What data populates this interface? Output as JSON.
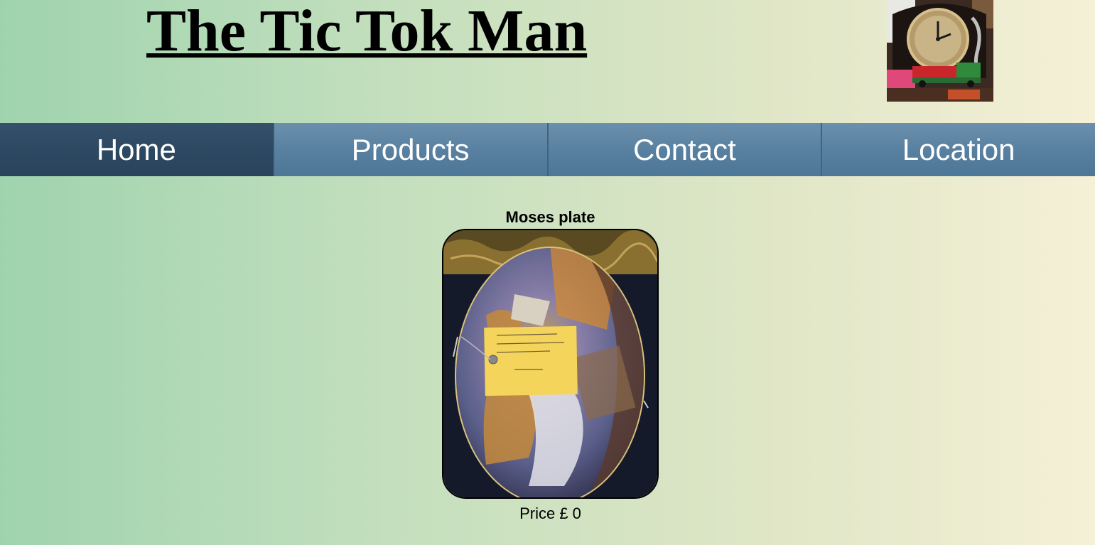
{
  "site": {
    "title": "The Tic Tok Man"
  },
  "nav": {
    "items": [
      {
        "label": "Home"
      },
      {
        "label": "Products"
      },
      {
        "label": "Contact"
      },
      {
        "label": "Location"
      }
    ],
    "active": "Home"
  },
  "product": {
    "name": "Moses plate",
    "price_label": "Price £ 0"
  },
  "colors": {
    "nav_bar": "#577f9f",
    "nav_active": "#2c4760",
    "text": "#000000"
  }
}
